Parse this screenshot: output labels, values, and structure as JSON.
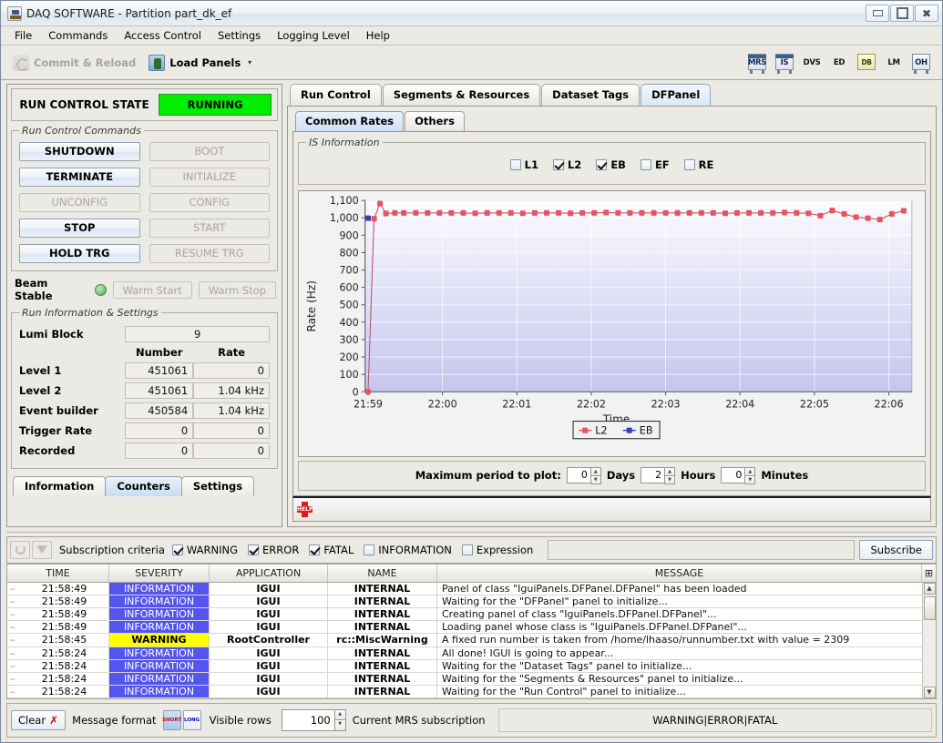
{
  "window": {
    "title": "DAQ SOFTWARE - Partition part_dk_ef",
    "app_icon": "daq-app-icon",
    "minimize": "minimize-icon",
    "maximize": "maximize-icon",
    "close": "close-icon"
  },
  "menubar": {
    "items": [
      {
        "label": "File"
      },
      {
        "label": "Commands"
      },
      {
        "label": "Access Control"
      },
      {
        "label": "Settings"
      },
      {
        "label": "Logging Level"
      },
      {
        "label": "Help"
      }
    ]
  },
  "toolbar": {
    "commit_label": "Commit & Reload",
    "load_panels_label": "Load Panels",
    "dropdown_arrow": "▾",
    "apps": [
      {
        "label": "MRS",
        "name": "mrs-icon"
      },
      {
        "label": "IS",
        "name": "is-icon"
      },
      {
        "label": "DVS",
        "name": "dvs-icon"
      },
      {
        "label": "ED",
        "name": "ed-icon"
      },
      {
        "label": "DB",
        "name": "db-icon"
      },
      {
        "label": "LM",
        "name": "lm-icon"
      },
      {
        "label": "OH",
        "name": "oh-icon"
      }
    ]
  },
  "run_control": {
    "state_label": "RUN CONTROL STATE",
    "state_value": "RUNNING",
    "state_color": "#00ee00",
    "commands_legend": "Run Control Commands",
    "commands": [
      {
        "label": "SHUTDOWN",
        "enabled": true
      },
      {
        "label": "BOOT",
        "enabled": false
      },
      {
        "label": "TERMINATE",
        "enabled": true
      },
      {
        "label": "INITIALIZE",
        "enabled": false
      },
      {
        "label": "UNCONFIG",
        "enabled": false
      },
      {
        "label": "CONFIG",
        "enabled": false
      },
      {
        "label": "STOP",
        "enabled": true
      },
      {
        "label": "START",
        "enabled": false
      },
      {
        "label": "HOLD TRG",
        "enabled": true
      },
      {
        "label": "RESUME TRG",
        "enabled": false
      }
    ],
    "beam_label": "Beam Stable",
    "beam_led": "green",
    "warm_start": "Warm Start",
    "warm_stop": "Warm Stop"
  },
  "run_info": {
    "legend": "Run Information & Settings",
    "lumi_label": "Lumi Block",
    "lumi_value": "9",
    "col_number": "Number",
    "col_rate": "Rate",
    "rows": [
      {
        "label": "Level 1",
        "number": "451061",
        "rate": "0"
      },
      {
        "label": "Level 2",
        "number": "451061",
        "rate": "1.04 kHz"
      },
      {
        "label": "Event builder",
        "number": "450584",
        "rate": "1.04 kHz"
      },
      {
        "label": "Trigger Rate",
        "number": "0",
        "rate": "0"
      },
      {
        "label": "Recorded",
        "number": "0",
        "rate": "0"
      }
    ],
    "tabs": [
      {
        "label": "Information",
        "selected": false
      },
      {
        "label": "Counters",
        "selected": true
      },
      {
        "label": "Settings",
        "selected": false
      }
    ]
  },
  "main_tabs": [
    {
      "label": "Run Control",
      "selected": false
    },
    {
      "label": "Segments & Resources",
      "selected": false
    },
    {
      "label": "Dataset Tags",
      "selected": false
    },
    {
      "label": "DFPanel",
      "selected": true
    }
  ],
  "sub_tabs": [
    {
      "label": "Common Rates",
      "selected": true
    },
    {
      "label": "Others",
      "selected": false
    }
  ],
  "is_information": {
    "legend": "IS Information",
    "checkboxes": [
      {
        "label": "L1",
        "checked": false
      },
      {
        "label": "L2",
        "checked": true
      },
      {
        "label": "EB",
        "checked": true
      },
      {
        "label": "EF",
        "checked": false
      },
      {
        "label": "RE",
        "checked": false
      }
    ]
  },
  "period": {
    "label": "Maximum period to plot:",
    "days_value": "0",
    "days_label": "Days",
    "hours_value": "2",
    "hours_label": "Hours",
    "minutes_value": "0",
    "minutes_label": "Minutes"
  },
  "help": {
    "icon": "help-icon",
    "label": "HELP"
  },
  "chart_data": {
    "type": "line",
    "title": "",
    "xlabel": "Time",
    "ylabel": "Rate (Hz)",
    "ylim": [
      0,
      1100
    ],
    "yticks": [
      0,
      100,
      200,
      300,
      400,
      500,
      600,
      700,
      800,
      900,
      1000,
      1100
    ],
    "ytick_labels": [
      "0",
      "100",
      "200",
      "300",
      "400",
      "500",
      "600",
      "700",
      "800",
      "900",
      "1,000",
      "1,100"
    ],
    "xticks": [
      "21:59",
      "22:00",
      "22:01",
      "22:02",
      "22:03",
      "22:04",
      "22:05",
      "22:06"
    ],
    "xlim_minutes": [
      0,
      7.35
    ],
    "grid": true,
    "legend_position": "bottom",
    "legend": [
      "L2",
      "EB"
    ],
    "series": [
      {
        "name": "L2",
        "color": "#e8535e",
        "x": [
          0.04,
          0.12,
          0.2,
          0.28,
          0.4,
          0.52,
          0.68,
          0.84,
          1.0,
          1.16,
          1.32,
          1.48,
          1.64,
          1.8,
          1.96,
          2.12,
          2.28,
          2.44,
          2.6,
          2.76,
          2.92,
          3.08,
          3.24,
          3.4,
          3.56,
          3.72,
          3.88,
          4.04,
          4.2,
          4.36,
          4.52,
          4.68,
          4.84,
          5.0,
          5.16,
          5.32,
          5.48,
          5.64,
          5.8,
          5.96,
          6.12,
          6.28,
          6.44,
          6.6,
          6.76,
          6.92,
          7.08,
          7.24
        ],
        "y": [
          0,
          995,
          1082,
          1025,
          1028,
          1028,
          1028,
          1028,
          1028,
          1028,
          1028,
          1026,
          1028,
          1028,
          1028,
          1026,
          1028,
          1028,
          1028,
          1026,
          1028,
          1028,
          1030,
          1028,
          1028,
          1028,
          1028,
          1028,
          1028,
          1028,
          1028,
          1028,
          1026,
          1028,
          1028,
          1028,
          1028,
          1030,
          1028,
          1026,
          1012,
          1042,
          1022,
          1004,
          998,
          990,
          1022,
          1040
        ]
      },
      {
        "name": "EB",
        "color": "#3b3bc8",
        "x": [
          0.04
        ],
        "y": [
          998
        ]
      }
    ]
  },
  "mrs": {
    "refresh_icon": "refresh-icon",
    "filter_icon": "filter-icon",
    "criteria_label": "Subscription criteria",
    "criteria": [
      {
        "label": "WARNING",
        "checked": true
      },
      {
        "label": "ERROR",
        "checked": true
      },
      {
        "label": "FATAL",
        "checked": true
      },
      {
        "label": "INFORMATION",
        "checked": false
      },
      {
        "label": "Expression",
        "checked": false
      }
    ],
    "expression_value": "",
    "subscribe_label": "Subscribe",
    "columns": [
      "TIME",
      "SEVERITY",
      "APPLICATION",
      "NAME",
      "MESSAGE"
    ],
    "rows": [
      {
        "time": "21:58:49",
        "severity": "INFORMATION",
        "application": "IGUI",
        "name": "INTERNAL",
        "message": "Panel of class \"IguiPanels.DFPanel.DFPanel\" has been loaded"
      },
      {
        "time": "21:58:49",
        "severity": "INFORMATION",
        "application": "IGUI",
        "name": "INTERNAL",
        "message": "Waiting for the \"DFPanel\" panel to initialize..."
      },
      {
        "time": "21:58:49",
        "severity": "INFORMATION",
        "application": "IGUI",
        "name": "INTERNAL",
        "message": "Creating panel of class \"IguiPanels.DFPanel.DFPanel\"..."
      },
      {
        "time": "21:58:49",
        "severity": "INFORMATION",
        "application": "IGUI",
        "name": "INTERNAL",
        "message": "Loading panel whose class is \"IguiPanels.DFPanel.DFPanel\"..."
      },
      {
        "time": "21:58:45",
        "severity": "WARNING",
        "application": "RootController",
        "name": "rc::MiscWarning",
        "message": "A fixed run number is taken from /home/lhaaso/runnumber.txt with value = 2309"
      },
      {
        "time": "21:58:24",
        "severity": "INFORMATION",
        "application": "IGUI",
        "name": "INTERNAL",
        "message": "All done! IGUI is going to appear..."
      },
      {
        "time": "21:58:24",
        "severity": "INFORMATION",
        "application": "IGUI",
        "name": "INTERNAL",
        "message": "Waiting for the \"Dataset Tags\" panel to initialize..."
      },
      {
        "time": "21:58:24",
        "severity": "INFORMATION",
        "application": "IGUI",
        "name": "INTERNAL",
        "message": "Waiting for the \"Segments & Resources\" panel to initialize..."
      },
      {
        "time": "21:58:24",
        "severity": "INFORMATION",
        "application": "IGUI",
        "name": "INTERNAL",
        "message": "Waiting for the \"Run Control\" panel to initialize..."
      }
    ]
  },
  "statusbar": {
    "clear_label": "Clear",
    "clear_icon": "clear-x-icon",
    "format_label": "Message format",
    "format_short": "SHORT",
    "format_long": "LONG",
    "visible_rows_label": "Visible rows",
    "visible_rows_value": "100",
    "mrs_sub_label": "Current MRS subscription",
    "mrs_sub_value": "WARNING|ERROR|FATAL"
  }
}
